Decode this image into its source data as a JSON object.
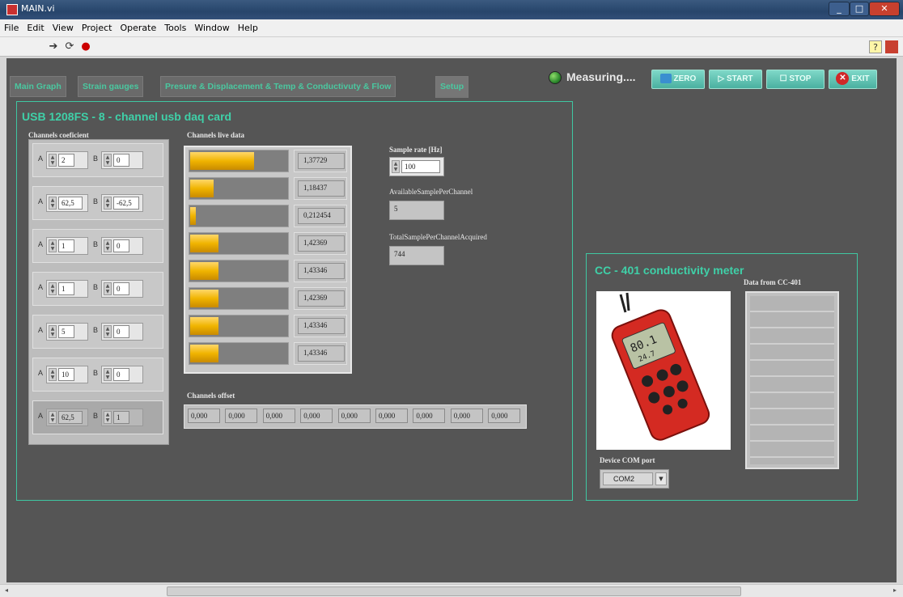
{
  "window": {
    "title": "MAIN.vi"
  },
  "menu": [
    "File",
    "Edit",
    "View",
    "Project",
    "Operate",
    "Tools",
    "Window",
    "Help"
  ],
  "toolbar": {
    "icons": [
      "run-arrow-icon",
      "run-continuous-icon",
      "abort-icon"
    ],
    "help_icon": "?"
  },
  "tabs": [
    {
      "label": "Main Graph"
    },
    {
      "label": "Strain gauges"
    },
    {
      "label": "Presure & Displacement & Temp & Conductivuty & Flow"
    },
    {
      "label": "Setup",
      "active": true
    }
  ],
  "status": {
    "label": "Measuring....",
    "led_color": "#2e8b2e"
  },
  "buttons": {
    "zero": "ZERO",
    "start": "START",
    "stop": "STOP",
    "exit": "EXIT"
  },
  "daq": {
    "title": "USB 1208FS - 8 - channel usb daq card",
    "coef_label": "Channels coeficient",
    "live_label": "Channels live data",
    "a_label": "A",
    "b_label": "B",
    "coefficients": [
      {
        "a": "2",
        "b": "0"
      },
      {
        "a": "62,5",
        "b": "-62,5"
      },
      {
        "a": "1",
        "b": "0"
      },
      {
        "a": "1",
        "b": "0"
      },
      {
        "a": "5",
        "b": "0"
      },
      {
        "a": "10",
        "b": "0"
      },
      {
        "a": "62,5",
        "b": "1"
      }
    ],
    "live": [
      {
        "value": "1,37729",
        "fill": 0.66
      },
      {
        "value": "1,18437",
        "fill": 0.24
      },
      {
        "value": "0,212454",
        "fill": 0.06
      },
      {
        "value": "1,42369",
        "fill": 0.29
      },
      {
        "value": "1,43346",
        "fill": 0.29
      },
      {
        "value": "1,42369",
        "fill": 0.29
      },
      {
        "value": "1,43346",
        "fill": 0.29
      },
      {
        "value": "1,43346",
        "fill": 0.29
      }
    ],
    "sample_rate_label": "Sample rate [Hz]",
    "sample_rate": "100",
    "available_label": "AvailableSamplePerChannel",
    "available": "5",
    "total_label": "TotalSamplePerChannelAcquired",
    "total": "744",
    "offset_label": "Channels offset",
    "offsets": [
      "0,000",
      "0,000",
      "0,000",
      "0,000",
      "0,000",
      "0,000",
      "0,000",
      "0,000",
      "0,000"
    ]
  },
  "cc": {
    "title": "CC - 401 conductivity meter",
    "data_label": "Data from CC-401",
    "com_label": "Device COM port",
    "com_value": "COM2",
    "device_reading": "80.1",
    "device_reading2": "24.7"
  },
  "colors": {
    "accent": "#3fc7a2",
    "panel_bg": "#555555",
    "bar": "#f0b400"
  }
}
